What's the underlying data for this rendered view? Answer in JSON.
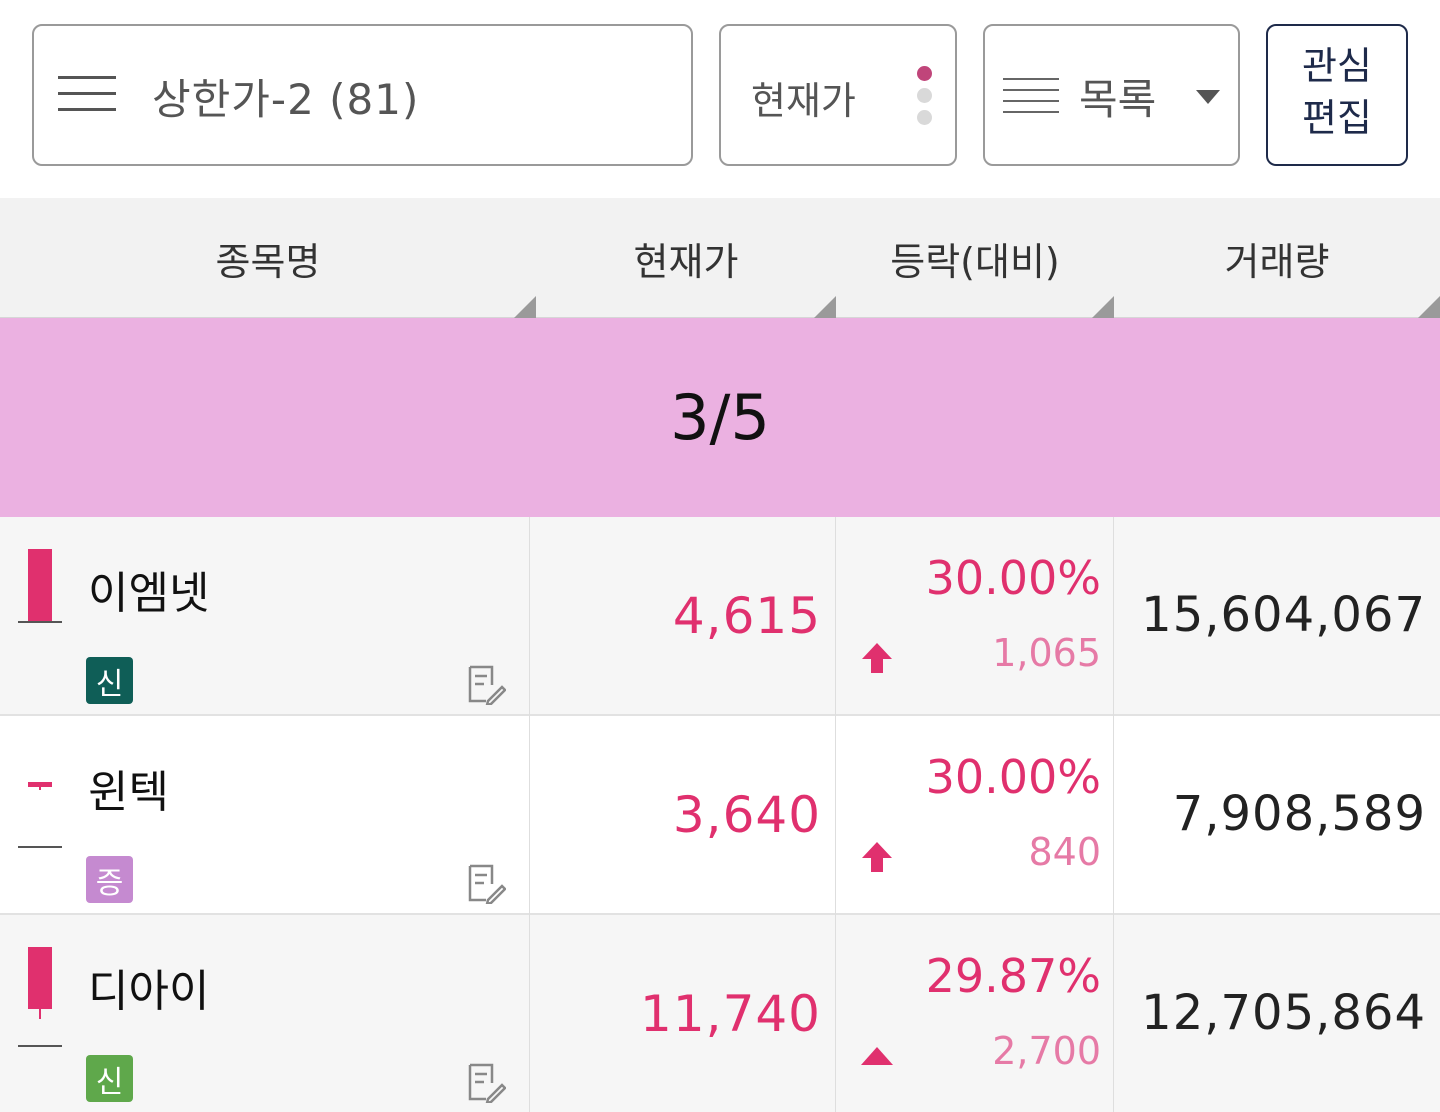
{
  "toolbar": {
    "group_title": "상한가-2 (81)",
    "price_label": "현재가",
    "view_label": "목록",
    "edit_line1": "관심",
    "edit_line2": "편집"
  },
  "table": {
    "headers": [
      "종목명",
      "현재가",
      "등락(대비)",
      "거래량"
    ],
    "page_indicator": "3/5",
    "rows": [
      {
        "name": "이엠넷",
        "badge": "신",
        "badge_color": "#0f5e57",
        "price": "4,615",
        "change_pct": "30.00%",
        "change_diff": "1,065",
        "arrow": "arrow-up-limit-icon",
        "volume": "15,604,067",
        "candle": "bullish"
      },
      {
        "name": "윈텍",
        "badge": "증",
        "badge_color": "#c58ad0",
        "price": "3,640",
        "change_pct": "30.00%",
        "change_diff": "840",
        "arrow": "arrow-up-limit-icon",
        "volume": "7,908,589",
        "candle": "doji"
      },
      {
        "name": "디아이",
        "badge": "신",
        "badge_color": "#5fa84b",
        "price": "11,740",
        "change_pct": "29.87%",
        "change_diff": "2,700",
        "arrow": "triangle-up-icon",
        "volume": "12,705,864",
        "candle": "bullish"
      }
    ]
  },
  "colors": {
    "up": "#e0306e",
    "up_light": "#e67aa6",
    "banner": "#ebb1e1",
    "header_bg": "#f2f2f2",
    "edit_border": "#1e2a4a"
  }
}
